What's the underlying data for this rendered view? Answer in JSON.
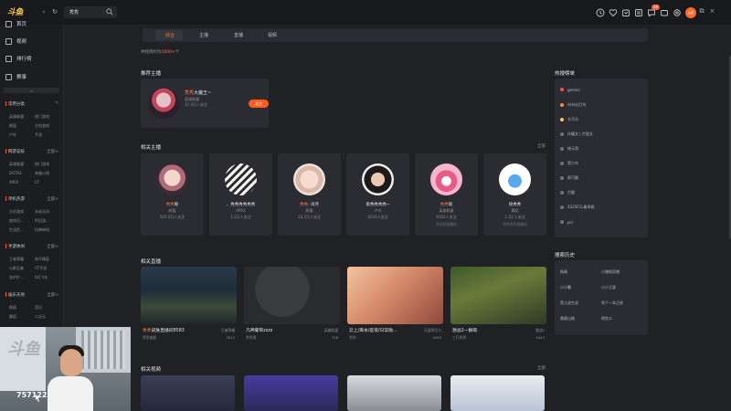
{
  "app": {
    "logo_text": "斗鱼",
    "search_value": "秀秀"
  },
  "topbar": {
    "badge_count": "26",
    "avatar_text": "头像"
  },
  "sidebar": {
    "items": [
      {
        "label": "首页"
      },
      {
        "label": "视频"
      },
      {
        "label": "排行榜"
      },
      {
        "label": "赛事"
      }
    ],
    "categories": [
      {
        "title": "常用分类",
        "more": "",
        "items": [
          "英雄联盟",
          "热门游戏",
          "颜值",
          "主机游戏",
          "户外",
          "手游"
        ]
      },
      {
        "title": "网游竞技",
        "more": "全部>",
        "items": [
          "英雄联盟",
          "热门游戏",
          "DOTA2",
          "穿越火线",
          "APEX",
          "CF"
        ]
      },
      {
        "title": "单机热游",
        "more": "全部>",
        "items": [
          "主机游戏",
          "永劫无间",
          "使命召...",
          "怀旧游...",
          "生化危...",
          "拉跨单机"
        ]
      },
      {
        "title": "手游休闲",
        "more": "全部>",
        "items": [
          "王者荣耀",
          "和平精英",
          "火影忍者",
          "CF手游",
          "金铲铲...",
          "QQ飞车"
        ]
      },
      {
        "title": "娱乐天地",
        "more": "全部>",
        "items": [
          "颜值",
          "音乐",
          "舞蹈",
          "二次元"
        ]
      }
    ]
  },
  "cam": {
    "panel_text": "斗鱼",
    "room_number": "757122"
  },
  "main": {
    "tabs": [
      "综合",
      "主播",
      "直播",
      "视频"
    ],
    "result_prefix": "共找到约为",
    "result_count": "1000+",
    "result_suffix": "个",
    "recommend_title": "推荐主播",
    "recommend": {
      "name_hl": "秀秀",
      "name_rest": "大魔王~",
      "category": "英雄联盟",
      "fans": "37.4万人关注",
      "follow_label": "关注"
    },
    "anchors_title": "相关主播",
    "anchors_more": "全部",
    "anchors": [
      {
        "name_hl": "秀秀",
        "name_rest": "呢",
        "category": "颜值",
        "fans": "102.4万人关注",
        "room": ""
      },
      {
        "name_hl": "",
        "name_rest": "、秀秀秀秀秀秀",
        "category": "APEX",
        "fans": "1.2万人关注",
        "room": ""
      },
      {
        "name_hl": "秀秀",
        "name_rest": "- 肖月",
        "category": "颜值",
        "fans": "10.3万人关注",
        "room": ""
      },
      {
        "name_hl": "",
        "name_rest": "爱秀秀秀秀~",
        "category": "户外",
        "fans": "4243人关注",
        "room": ""
      },
      {
        "name_hl": "秀秀",
        "name_rest": "呢",
        "category": "英雄联盟",
        "fans": "9102人关注",
        "room": "秀秀呢直播间"
      },
      {
        "name_hl": "",
        "name_rest": "徐秀秀",
        "category": "舞蹈",
        "fans": "1.3万人关注",
        "room": "徐秀秀的直播间"
      }
    ],
    "videos_title": "相关直播",
    "videos": [
      {
        "title_hl": "秀秀",
        "title_rest": "皮肤直播间8583",
        "tag": "王者荣耀",
        "channel": "秀秀皮肤",
        "hot": "3012"
      },
      {
        "title_hl": "",
        "title_rest": "凡神葡萄zzzz",
        "tag": "英雄联盟",
        "channel": "秀秀哥",
        "hot": "718"
      },
      {
        "title_hl": "",
        "title_rest": "云上/离本/逛夜/日常助...",
        "tag": "天涯明月刀",
        "channel": "秀秀~",
        "hot": "4095"
      },
      {
        "title_hl": "",
        "title_rest": "激战2一群萌",
        "tag": "激战2",
        "channel": "三只秀秀",
        "hot": "9443"
      }
    ],
    "rel_videos_title": "相关视频",
    "rel_videos_more": "全部",
    "hot_title": "热搜榜单",
    "hot": [
      "gemini",
      "dshi幻灯鸟",
      "大司马",
      "孙耀文 | 芒敖文",
      "统元哥",
      "黑小鸟",
      "即可酸",
      "白猫",
      "2025FCL春季赛",
      "pcl"
    ],
    "hot_colors": [
      "#ff4d4f",
      "#ff8a3d",
      "#ffc94d",
      "#6f7278",
      "#6f7278",
      "#6f7278",
      "#6f7278",
      "#6f7278",
      "#6f7278",
      "#6f7278"
    ],
    "history_title": "搜索历史",
    "history": [
      "杨倩",
      "小猪佩奇猪",
      "小小薯",
      "小小王版",
      "黑儿虎生虎",
      "秀个一本正经",
      "悬疑山楂",
      "明宫义"
    ]
  },
  "colors": {
    "accent": "#ff7a3c",
    "follow": "#ff5a1f"
  }
}
